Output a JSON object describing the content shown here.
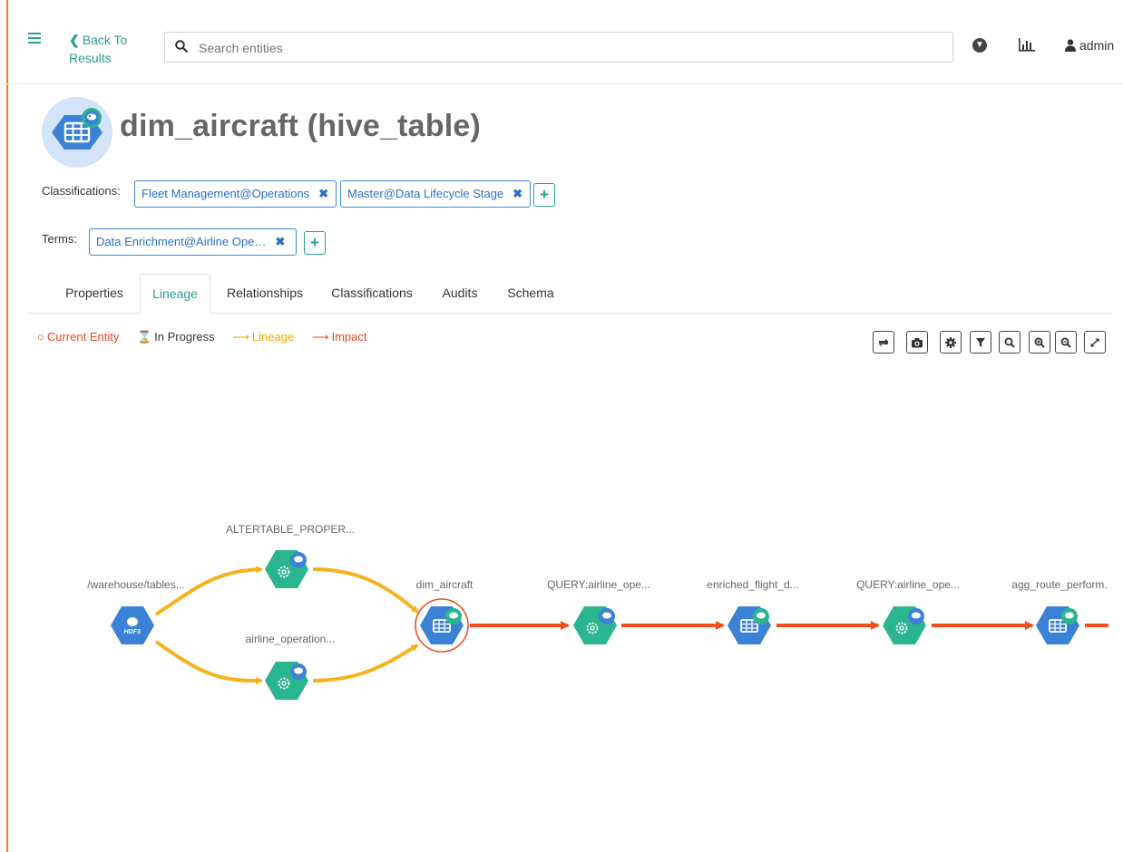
{
  "nav": {
    "back_label": "Back To Results",
    "search_placeholder": "Search entities",
    "user_name": "admin"
  },
  "entity": {
    "title": "dim_aircraft (hive_table)"
  },
  "classifications": {
    "label": "Classifications:",
    "tags": [
      "Fleet Management@Operations",
      "Master@Data Lifecycle Stage"
    ]
  },
  "terms": {
    "label": "Terms:",
    "tags": [
      "Data Enrichment@Airline Ope…"
    ]
  },
  "tabs": [
    "Properties",
    "Lineage",
    "Relationships",
    "Classifications",
    "Audits",
    "Schema"
  ],
  "active_tab": "Lineage",
  "legend": {
    "current": "Current Entity",
    "in_progress": "In Progress",
    "lineage": "Lineage",
    "impact": "Impact"
  },
  "lineage": {
    "nodes": [
      {
        "label": "/warehouse/tables...",
        "kind": "hdfs",
        "icon_text": "HDFS"
      },
      {
        "label": "ALTERTABLE_PROPER...",
        "kind": "process"
      },
      {
        "label": "airline_operation...",
        "kind": "process"
      },
      {
        "label": "dim_aircraft",
        "kind": "table"
      },
      {
        "label": "QUERY:airline_ope...",
        "kind": "process"
      },
      {
        "label": "enriched_flight_d...",
        "kind": "table"
      },
      {
        "label": "QUERY:airline_ope...",
        "kind": "process"
      },
      {
        "label": "agg_route_perform.",
        "kind": "table"
      }
    ]
  },
  "colors": {
    "accent": "#2a9d8f",
    "lineage": "#f5b21c",
    "impact": "#f24e1e",
    "table_node": "#3b82d6",
    "process_node": "#2bb58f"
  }
}
